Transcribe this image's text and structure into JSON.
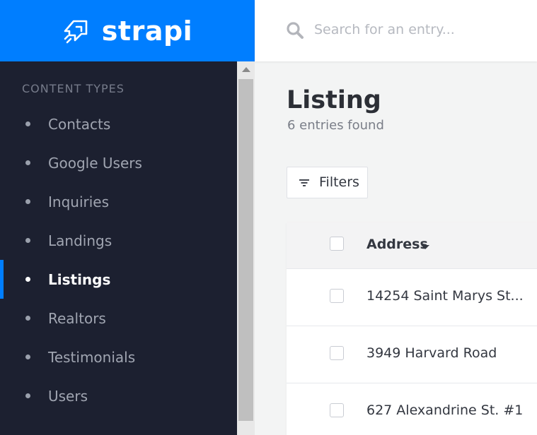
{
  "brand": {
    "name": "strapi",
    "logo_icon": "rocket-icon"
  },
  "colors": {
    "brand": "#007eff",
    "sidebar": "#1c2030",
    "active_indicator": "#007eff"
  },
  "sidebar": {
    "section_title": "CONTENT TYPES",
    "items": [
      {
        "label": "Contacts",
        "active": false
      },
      {
        "label": "Google Users",
        "active": false
      },
      {
        "label": "Inquiries",
        "active": false
      },
      {
        "label": "Landings",
        "active": false
      },
      {
        "label": "Listings",
        "active": true
      },
      {
        "label": "Realtors",
        "active": false
      },
      {
        "label": "Testimonials",
        "active": false
      },
      {
        "label": "Users",
        "active": false
      }
    ]
  },
  "header": {
    "search_placeholder": "Search for an entry...",
    "search_value": "",
    "search_icon": "search-icon"
  },
  "main": {
    "title": "Listing",
    "subtitle": "6 entries found",
    "filters_label": "Filters",
    "filters_icon": "filter-icon"
  },
  "table": {
    "columns": [
      {
        "label": "Address",
        "sort": "desc"
      }
    ],
    "rows": [
      {
        "address": "14254 Saint Marys St..."
      },
      {
        "address": "3949 Harvard Road"
      },
      {
        "address": "627 Alexandrine St. #1"
      }
    ]
  }
}
